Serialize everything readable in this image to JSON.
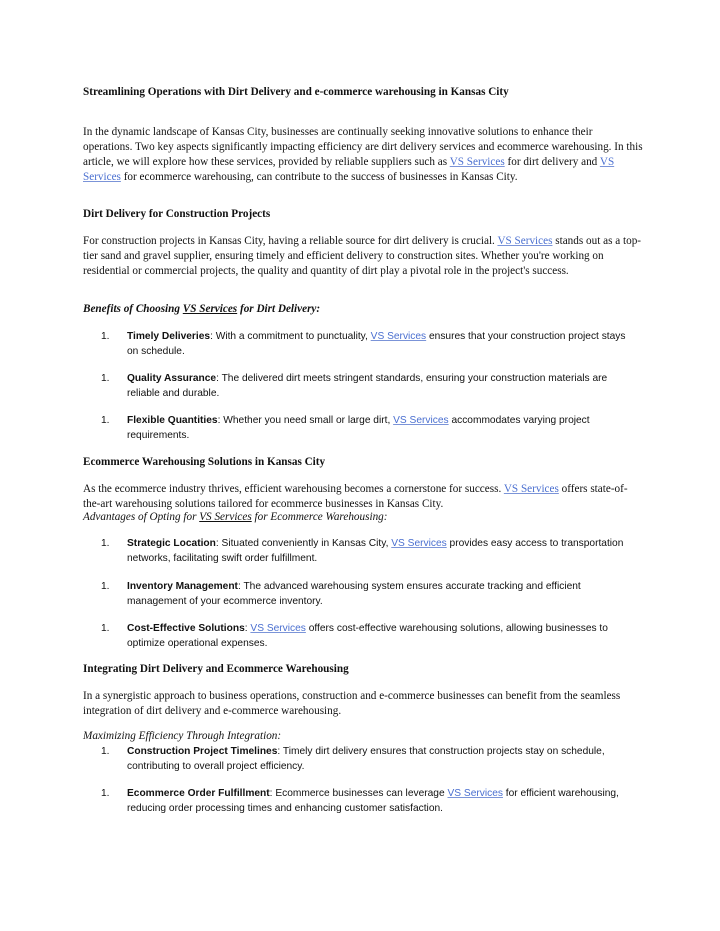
{
  "document": {
    "title": "Streamlining Operations with Dirt Delivery and e-commerce warehousing in Kansas City",
    "link_text": "VS Services",
    "link_color": "#4a6fd0",
    "intro": {
      "p1": "In the dynamic landscape of Kansas City, businesses are continually seeking innovative solutions to enhance their operations. Two key aspects significantly impacting efficiency are dirt delivery services and ecommerce warehousing. In this article, we will explore how these services, provided by reliable suppliers such as ",
      "p2": " for dirt delivery and ",
      "p3": " for ecommerce warehousing, can contribute to the success of businesses in Kansas City."
    },
    "section1": {
      "heading": "Dirt Delivery for Construction Projects",
      "para_a": "For construction projects in Kansas City, having a reliable source for dirt delivery is crucial. ",
      "para_b": " stands out as a top-tier sand and gravel supplier, ensuring timely and efficient delivery to construction sites. Whether you're working on residential or commercial projects, the quality and quantity of dirt play a pivotal role in the project's success.",
      "subheading_a": "Benefits of Choosing ",
      "subheading_b": " for Dirt Delivery:",
      "items": [
        {
          "num": "1.",
          "bold": "Timely Deliveries",
          "a": ": With a commitment to punctuality, ",
          "b": " ensures that your construction project stays on schedule."
        },
        {
          "num": "1.",
          "bold": "Quality Assurance",
          "a": ": The delivered dirt meets stringent standards, ensuring your construction materials are reliable and durable."
        },
        {
          "num": "1.",
          "bold": "Flexible Quantities",
          "a": ": Whether you need small or large dirt, ",
          "b": " accommodates varying project requirements."
        }
      ]
    },
    "section2": {
      "heading": "Ecommerce Warehousing Solutions in Kansas City",
      "para_a": "As the ecommerce industry thrives, efficient warehousing becomes a cornerstone for success. ",
      "para_b": " offers state-of-the-art warehousing solutions tailored for ecommerce businesses in Kansas City.",
      "subheading_a": "Advantages of Opting for ",
      "subheading_b": " for Ecommerce Warehousing:",
      "items": [
        {
          "num": "1.",
          "bold": "Strategic Location",
          "a": ": Situated conveniently in Kansas City, ",
          "b": " provides easy access to transportation networks, facilitating swift order fulfillment."
        },
        {
          "num": "1.",
          "bold": "Inventory Management",
          "a": ": The advanced warehousing system ensures accurate tracking and efficient management of your ecommerce inventory."
        },
        {
          "num": "1.",
          "bold": "Cost-Effective Solutions",
          "a": ": ",
          "b": " offers cost-effective warehousing solutions, allowing businesses to optimize operational expenses."
        }
      ]
    },
    "section3": {
      "heading": "Integrating Dirt Delivery and Ecommerce Warehousing",
      "para": "In a synergistic approach to business operations, construction and e-commerce businesses can benefit from the seamless integration of dirt delivery and e-commerce warehousing.",
      "subheading": "Maximizing Efficiency Through Integration:",
      "items": [
        {
          "num": "1.",
          "bold": "Construction Project Timelines",
          "a": ": Timely dirt delivery ensures that construction projects stay on schedule, contributing to overall project efficiency."
        },
        {
          "num": "1.",
          "bold": "Ecommerce Order Fulfillment",
          "a": ": Ecommerce businesses can leverage ",
          "b": " for efficient warehousing, reducing order processing times and enhancing customer satisfaction."
        }
      ]
    }
  }
}
